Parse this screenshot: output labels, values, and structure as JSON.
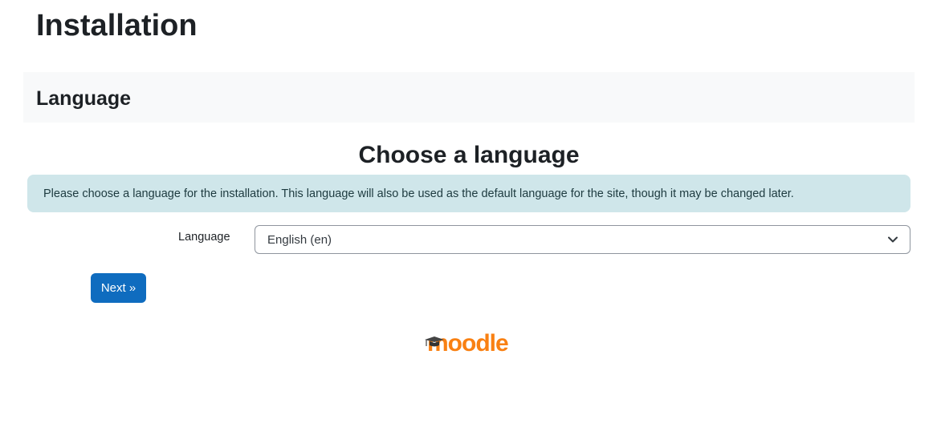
{
  "header": {
    "title": "Installation"
  },
  "section": {
    "title": "Language"
  },
  "form": {
    "heading": "Choose a language",
    "info": "Please choose a language for the installation. This language will also be used as the default language for the site, though it may be changed later.",
    "language_label": "Language",
    "language_value": "English (en)",
    "next_label": "Next »"
  },
  "footer": {
    "logo_text": "moodle"
  },
  "colors": {
    "primary": "#0f6cbf",
    "alert_bg": "#cfe6ea",
    "section_bg": "#f8f9fa",
    "brand_orange": "#f98012"
  },
  "icons": {
    "select_chevron": "chevron-down-icon",
    "logo_cap": "graduation-cap-icon"
  }
}
